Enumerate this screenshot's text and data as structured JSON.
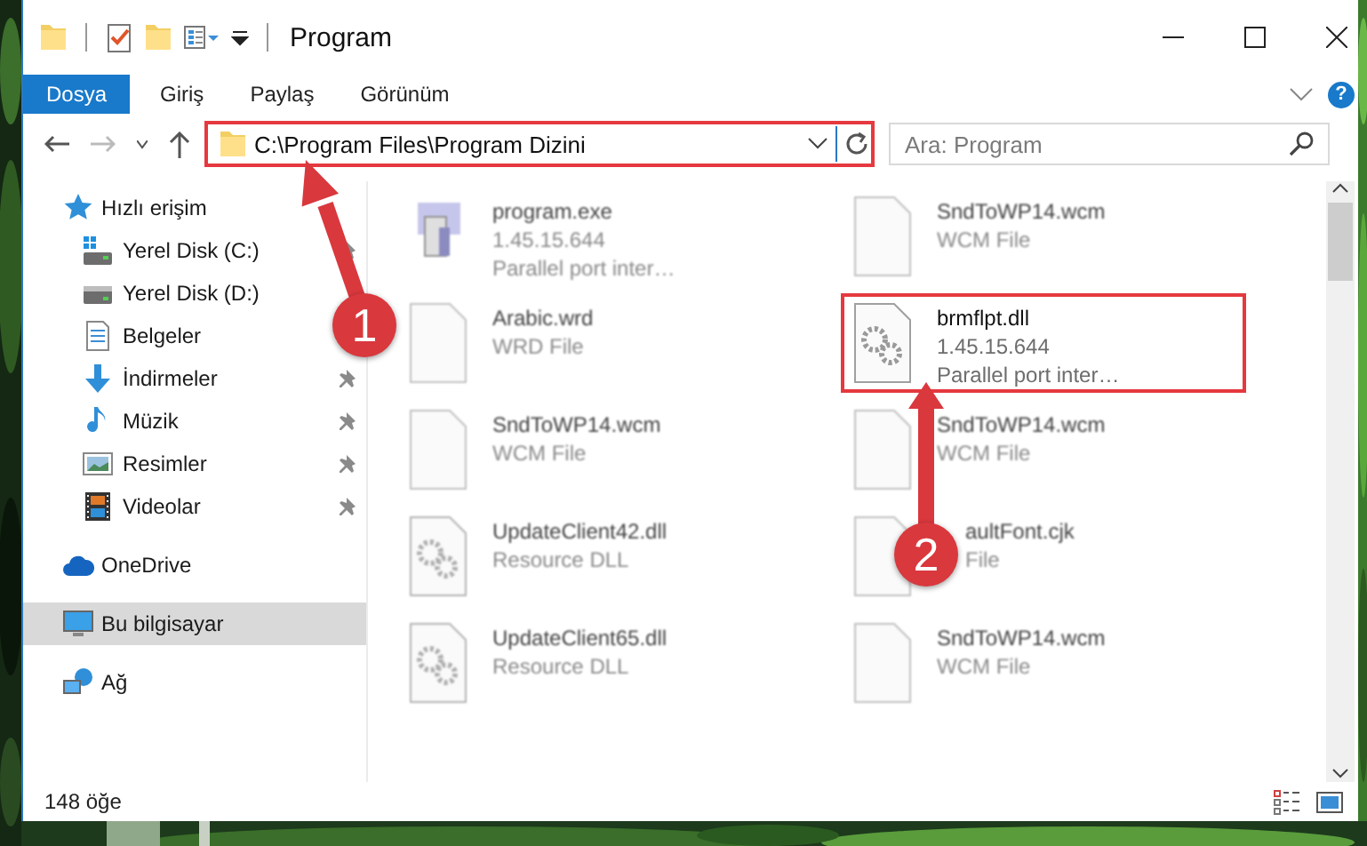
{
  "window": {
    "title": "Program"
  },
  "ribbon": {
    "tabs": [
      {
        "label": "Dosya",
        "kind": "file"
      },
      {
        "label": "Giriş",
        "kind": "tab"
      },
      {
        "label": "Paylaş",
        "kind": "tab"
      },
      {
        "label": "Görünüm",
        "kind": "tab"
      }
    ],
    "help": "?"
  },
  "address_bar": {
    "path": "C:\\Program Files\\Program Dizini",
    "highlighted": true
  },
  "search": {
    "placeholder": "Ara: Program"
  },
  "sidebar": {
    "items": [
      {
        "label": "Hızlı erişim",
        "kind": "star",
        "pinned": false,
        "selected": false,
        "children": [
          {
            "label": "Yerel Disk (C:)",
            "kind": "windrive",
            "pinned": true,
            "selected": false
          },
          {
            "label": "Yerel Disk (D:)",
            "kind": "drive",
            "pinned": false,
            "selected": false
          },
          {
            "label": "Belgeler",
            "kind": "document",
            "pinned": false,
            "selected": false
          },
          {
            "label": "İndirmeler",
            "kind": "download",
            "pinned": true,
            "selected": false
          },
          {
            "label": "Müzik",
            "kind": "music",
            "pinned": true,
            "selected": false
          },
          {
            "label": "Resimler",
            "kind": "pictures",
            "pinned": true,
            "selected": false
          },
          {
            "label": "Videolar",
            "kind": "video",
            "pinned": true,
            "selected": false
          }
        ]
      },
      {
        "label": "OneDrive",
        "kind": "cloud",
        "pinned": false,
        "selected": false
      },
      {
        "label": "Bu bilgisayar",
        "kind": "computer",
        "pinned": false,
        "selected": true
      },
      {
        "label": "Ağ",
        "kind": "network",
        "pinned": false,
        "selected": false
      }
    ]
  },
  "files": [
    {
      "name": "program.exe",
      "details": [
        "1.45.15.644",
        "Parallel port inter…"
      ],
      "kind": "exe",
      "highlighted": false,
      "blurred": true,
      "partly_hidden": false
    },
    {
      "name": "SndToWP14.wcm",
      "details": [
        "WCM File"
      ],
      "kind": "file",
      "highlighted": false,
      "blurred": true,
      "partly_hidden": false
    },
    {
      "name": "Arabic.wrd",
      "details": [
        "WRD File"
      ],
      "kind": "file",
      "highlighted": false,
      "blurred": true,
      "partly_hidden": false
    },
    {
      "name": "brmflpt.dll",
      "details": [
        "1.45.15.644",
        "Parallel port inter…"
      ],
      "kind": "gear",
      "highlighted": true,
      "blurred": false,
      "partly_hidden": false
    },
    {
      "name": "SndToWP14.wcm",
      "details": [
        "WCM File"
      ],
      "kind": "file",
      "highlighted": false,
      "blurred": true,
      "partly_hidden": false
    },
    {
      "name": "SndToWP14.wcm",
      "details": [
        "WCM File"
      ],
      "kind": "file",
      "highlighted": false,
      "blurred": true,
      "partly_hidden": false
    },
    {
      "name": "UpdateClient42.dll",
      "details": [
        "Resource DLL"
      ],
      "kind": "gear",
      "highlighted": false,
      "blurred": true,
      "partly_hidden": false
    },
    {
      "name": "aultFont.cjk",
      "details": [
        "File"
      ],
      "kind": "file",
      "highlighted": false,
      "blurred": true,
      "partly_hidden": true
    },
    {
      "name": "UpdateClient65.dll",
      "details": [
        "Resource DLL"
      ],
      "kind": "gear",
      "highlighted": false,
      "blurred": true,
      "partly_hidden": false
    },
    {
      "name": "SndToWP14.wcm",
      "details": [
        "WCM File"
      ],
      "kind": "file",
      "highlighted": false,
      "blurred": true,
      "partly_hidden": false
    }
  ],
  "status_bar": {
    "item_count": "148 öğe"
  },
  "annotations": [
    {
      "label": "1"
    },
    {
      "label": "2"
    }
  ]
}
